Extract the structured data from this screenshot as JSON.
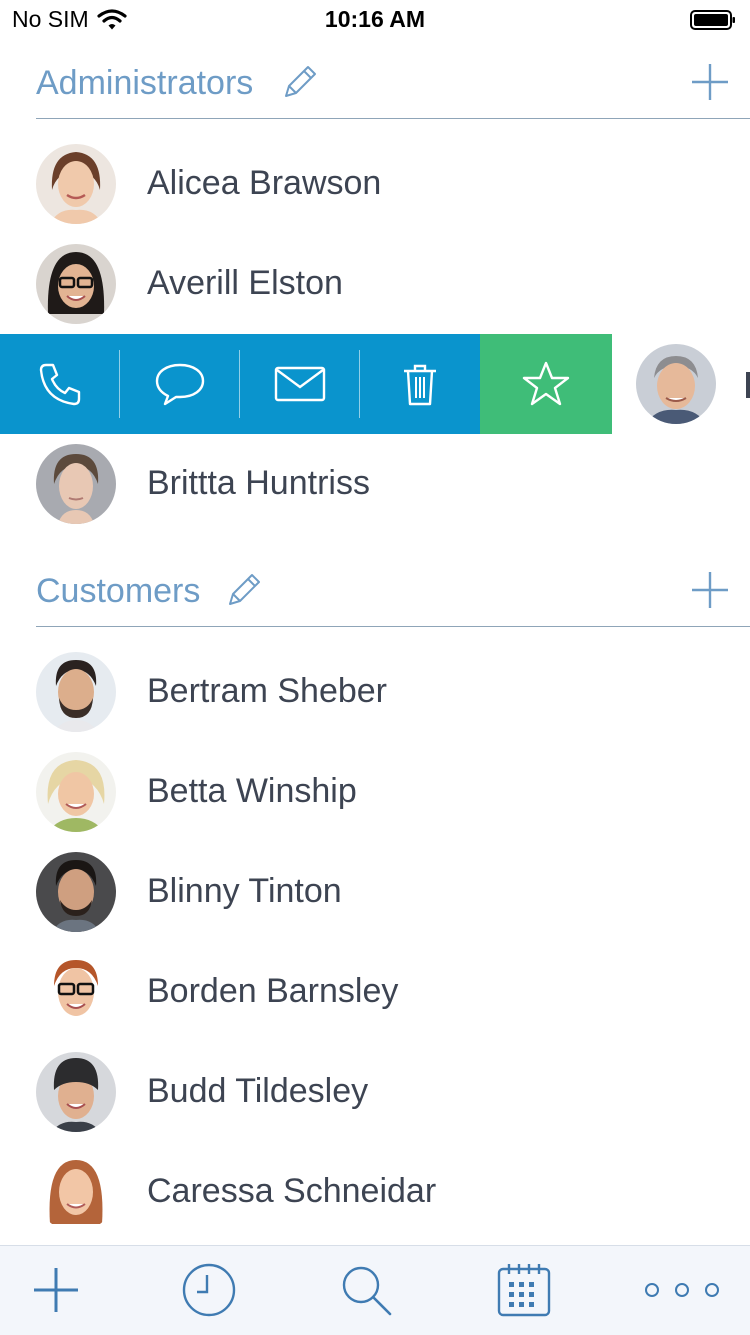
{
  "status": {
    "carrier": "No SIM",
    "time": "10:16 AM"
  },
  "colors": {
    "accent": "#6e9cc6",
    "swipe_blue": "#0a94cd",
    "swipe_green": "#3fbd78",
    "divider": "#8fa5b8"
  },
  "sections": [
    {
      "title": "Administrators",
      "edit_icon": "pencil-icon",
      "add_icon": "plus-icon",
      "contacts": [
        {
          "name": "Alicea Brawson"
        },
        {
          "name": "Averill Elston"
        },
        {
          "name": "Brittta Huntriss"
        }
      ]
    },
    {
      "title": "Customers",
      "edit_icon": "pencil-icon",
      "add_icon": "plus-icon",
      "contacts": [
        {
          "name": "Bertram Sheber"
        },
        {
          "name": "Betta Winship"
        },
        {
          "name": "Blinny Tinton"
        },
        {
          "name": "Borden Barnsley"
        },
        {
          "name": "Budd Tildesley"
        },
        {
          "name": "Caressa Schneidar"
        }
      ]
    }
  ],
  "swipe_actions": [
    "phone-icon",
    "message-icon",
    "mail-icon",
    "trash-icon",
    "star-icon"
  ],
  "tab_bar": [
    "plus-icon",
    "clock-icon",
    "search-icon",
    "calendar-icon",
    "more-icon"
  ]
}
